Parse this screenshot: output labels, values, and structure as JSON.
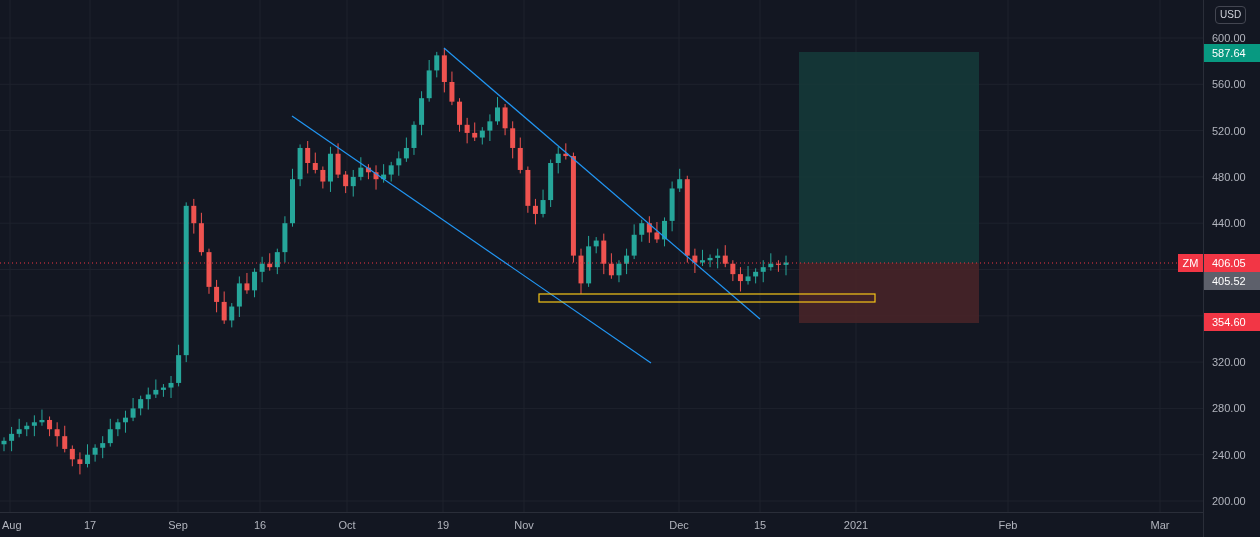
{
  "symbol": "ZM",
  "currency": "USD",
  "price_axis": {
    "ticks": [
      "600.00",
      "560.00",
      "520.00",
      "480.00",
      "440.00",
      "320.00",
      "280.00",
      "240.00",
      "200.00"
    ]
  },
  "price_badges": [
    {
      "kind": "target",
      "text": "587.64"
    },
    {
      "kind": "last",
      "text": "406.05"
    },
    {
      "kind": "previous",
      "text": "405.52"
    },
    {
      "kind": "stop",
      "text": "354.60"
    }
  ],
  "time_axis": [
    "Aug",
    "17",
    "Sep",
    "16",
    "Oct",
    "19",
    "Nov",
    "Dec",
    "15",
    "2021",
    "Feb",
    "Mar"
  ]
}
